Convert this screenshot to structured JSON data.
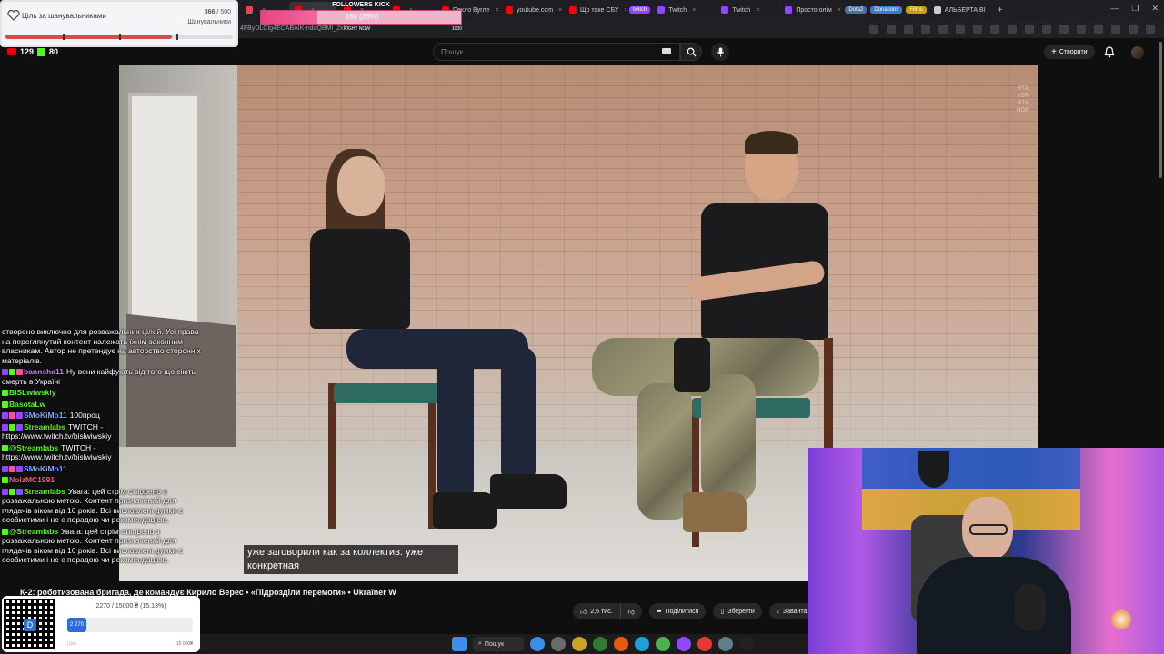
{
  "browser": {
    "tabs": [
      {
        "label": "",
        "color": "#e5484d",
        "active": false
      },
      {
        "label": "",
        "color": "#ff0000",
        "active": true
      },
      {
        "label": "",
        "color": "#ff0000",
        "active": false
      },
      {
        "label": "",
        "color": "#ff0000",
        "active": false
      },
      {
        "label": "Пекло Вугле",
        "color": "#ff0000",
        "active": false
      },
      {
        "label": "youtube.com",
        "color": "#ff0000",
        "active": false
      },
      {
        "label": "Що таке СБУ",
        "color": "#ff0000",
        "active": false
      },
      {
        "label": "Twitch",
        "color": "#9146ff",
        "active": false
      },
      {
        "label": "Twitch",
        "color": "#9146ff",
        "active": false
      },
      {
        "label": "Просто олім",
        "color": "#9146ff",
        "active": false
      },
      {
        "label": "АЛЬБЕРТА ВІ",
        "color": "#cccccc",
        "active": false
      }
    ],
    "pills": [
      {
        "label": "twitch",
        "color": "#9146ff"
      },
      {
        "label": "Dota2",
        "color": "#4a6fa5"
      },
      {
        "label": "Donations",
        "color": "#3a7bd5"
      },
      {
        "label": "Films",
        "color": "#c4a000"
      }
    ],
    "url_fragment": "4FByDLCIg4ECABAIK-ndaQBMI_2xY",
    "window_controls": [
      "—",
      "❐",
      "✕"
    ]
  },
  "youtube": {
    "search_placeholder": "Пошук",
    "create_label": "Створити",
    "video_title": "К-2: роботизована бригада, де командує Кирило Верес • «Підрозділи перемоги» • Ukraïner W",
    "subtitle_lines": "уже заговорили как за коллектив. уже конкретная",
    "watermark_lines": [
      "RTX",
      "VSR",
      "RTX",
      "HDR"
    ],
    "actions": {
      "like_count": "2,6 тис.",
      "share": "Поділитися",
      "save": "Зберегти",
      "download": "Заванта"
    }
  },
  "overlays": {
    "goal": {
      "title": "Ціль за шанувальниками",
      "current": "366",
      "separator": "/",
      "target": "500",
      "unit": "Шанувальники",
      "progress": 0.732
    },
    "followers_kick": {
      "title": "FOLLOWERS KICK",
      "value_text": "289 (28%)",
      "progress": 0.28,
      "left_label": "RIGHT NOW",
      "right_label": "1000"
    },
    "viewers": {
      "youtube": "129",
      "kick": "80"
    },
    "donation_goal": {
      "summary": "2270 / 15000 ₴ (15.13%)",
      "current_label": "2 270",
      "progress": 0.1513,
      "left_label": "Ціль",
      "max_label": "15 000₴"
    }
  },
  "chat": [
    {
      "nick": "",
      "text": "створено виключно для розважальних цілей. Усі права на переглянутий контент належать їхнім законним власникам. Автор не претендує на авторство сторонніх матеріалів.",
      "color": "#ffffff",
      "badges": []
    },
    {
      "nick": "bannsha11",
      "text": "Ну вони кайфують від того що сіють смерть в Україні",
      "color": "#b980ff",
      "badges": [
        "#9146ff",
        "#53fc18",
        "#ff4fa0"
      ]
    },
    {
      "nick": "BISLwiwskiy",
      "text": "",
      "color": "#53fc18",
      "badges": [
        "#53fc18"
      ]
    },
    {
      "nick": "BasotaLw",
      "text": "",
      "color": "#53fc18",
      "badges": [
        "#53fc18"
      ]
    },
    {
      "nick": "SMoKiMo11",
      "text": "100проц",
      "color": "#7aa7ff",
      "badges": [
        "#9146ff",
        "#ff4fa0",
        "#9146ff"
      ]
    },
    {
      "nick": "Streamlabs",
      "text": "TWITCH - https://www.twitch.tv/bislwiwskiy",
      "color": "#53fc18",
      "badges": [
        "#9146ff",
        "#53fc18",
        "#9146ff"
      ]
    },
    {
      "nick": "@Streamlabs",
      "text": "TWITCH - https://www.twitch.tv/bislwiwskiy",
      "color": "#53fc18",
      "badges": [
        "#53fc18"
      ]
    },
    {
      "nick": "SMoKiMo11",
      "text": "",
      "color": "#7aa7ff",
      "badges": [
        "#9146ff",
        "#ff4fa0",
        "#9146ff"
      ]
    },
    {
      "nick": "NoizMC1991",
      "text": "",
      "color": "#ff5a7a",
      "badges": [
        "#53fc18"
      ]
    },
    {
      "nick": "Streamlabs",
      "text": "Увага: цей стрім створено з розважальною метою. Контент призначений для глядачів віком від 16 років. Всі висловлені думки є особистими і не є порадою чи рекомендацією.",
      "color": "#53fc18",
      "badges": [
        "#9146ff",
        "#53fc18",
        "#9146ff"
      ]
    },
    {
      "nick": "@Streamlabs",
      "text": "Увага: цей стрім створено з розважальною метою. Контент призначений для глядачів віком від 16 років. Всі висловлені думки є особистими і не є порадою чи рекомендацією.",
      "color": "#53fc18",
      "badges": [
        "#53fc18"
      ]
    }
  ],
  "taskbar": {
    "search_label": "Пошук",
    "icon_colors": [
      "#3b8eea",
      "#6b6b6b",
      "#c9a227",
      "#2e7d32",
      "#e8590c",
      "#229ed9",
      "#4caf50",
      "#9146ff",
      "#e53935",
      "#607d8b",
      "#222222"
    ]
  }
}
